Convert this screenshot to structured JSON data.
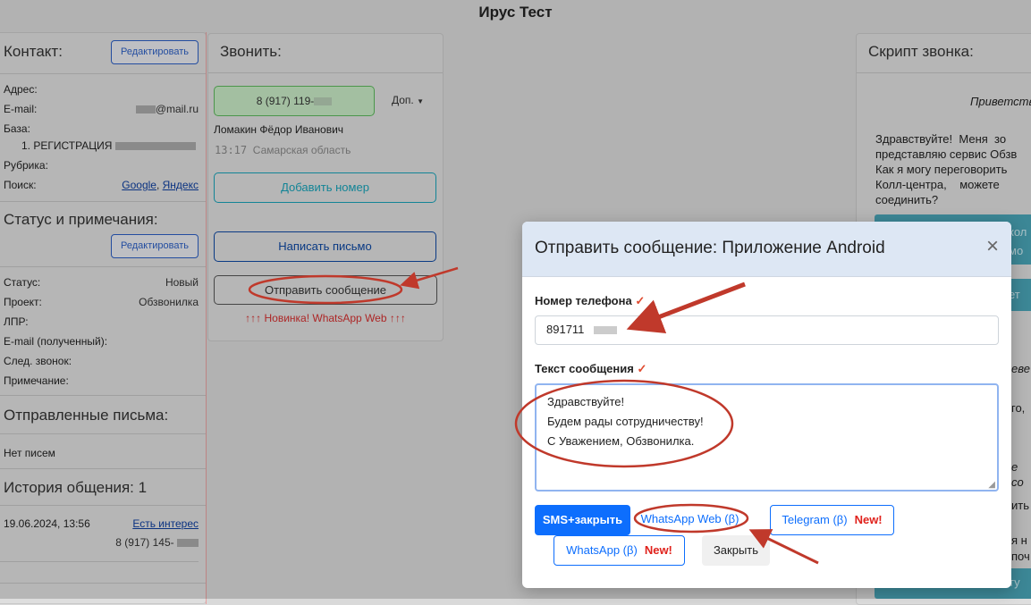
{
  "app": {
    "title": "Ирус Тест"
  },
  "contact": {
    "title": "Контакт:",
    "edit_label": "Редактировать",
    "fields": {
      "address": "Адрес:",
      "email": "E-mail:",
      "email_value": "@mail.ru",
      "base": "База:",
      "base_value": "1. РЕГИСТРАЦИЯ",
      "rubric": "Рубрика:",
      "search": "Поиск:",
      "google": "Google",
      "yandex": "Яндекс"
    }
  },
  "status": {
    "title": "Статус и примечания:",
    "edit_label": "Редактировать",
    "rows": [
      {
        "label": "Статус:",
        "value": "Новый"
      },
      {
        "label": "Проект:",
        "value": "Обзвонилка"
      },
      {
        "label": "ЛПР:",
        "value": ""
      },
      {
        "label": "E-mail (полученный):",
        "value": ""
      },
      {
        "label": "След. звонок:",
        "value": ""
      },
      {
        "label": "Примечание:",
        "value": ""
      }
    ]
  },
  "letters": {
    "title": "Отправленные письма:",
    "empty": "Нет писем"
  },
  "history": {
    "title": "История общения: 1",
    "date": "19.06.2024, 13:56",
    "status_link": "Есть интерес",
    "phone": "8 (917) 145-"
  },
  "call": {
    "title": "Звонить:",
    "phone_button": "8 (917) 119-",
    "more_label": "Доп.",
    "name": "Ломакин Фёдор Иванович",
    "time": "13:17",
    "region": "Самарская область",
    "add_number": "Добавить номер",
    "write_letter": "Написать письмо",
    "send_message": "Отправить сообщение",
    "promo": "↑↑↑ Новинка! WhatsApp Web ↑↑↑"
  },
  "script": {
    "title": "Скрипт звонка:",
    "greeting": "Приветств",
    "body": [
      "Здравствуйте!  Меня  зо",
      "представляю сервис Обзв",
      "Как я могу переговорить",
      "Колл-центра,    можете",
      "соединить?"
    ],
    "fragments": [
      "кол",
      "мо",
      "ет",
      "еве",
      "го,",
      "е со",
      "ить",
      "я н",
      "поч",
      "ту"
    ]
  },
  "modal": {
    "title": "Отправить сообщение: Приложение Android",
    "close": "×",
    "phone_label": "Номер телефона",
    "phone_value": "891711",
    "text_label": "Текст сообщения",
    "check_mark": "✓",
    "message_lines": [
      "Здравствуйте!",
      "Будем рады сотрудничеству!",
      "С Уважением, Обзвонилка."
    ],
    "buttons": {
      "sms": "SMS+закрыть",
      "whatsapp_web": "WhatsApp Web (β)",
      "telegram": "Telegram (β)",
      "whatsapp": "WhatsApp (β)",
      "new_badge": "New!",
      "close": "Закрыть"
    }
  },
  "colors": {
    "primary": "#0d6efd",
    "annotation_red": "#c0392b",
    "success_border": "#5cb85c",
    "info_border": "#17a2b8"
  }
}
